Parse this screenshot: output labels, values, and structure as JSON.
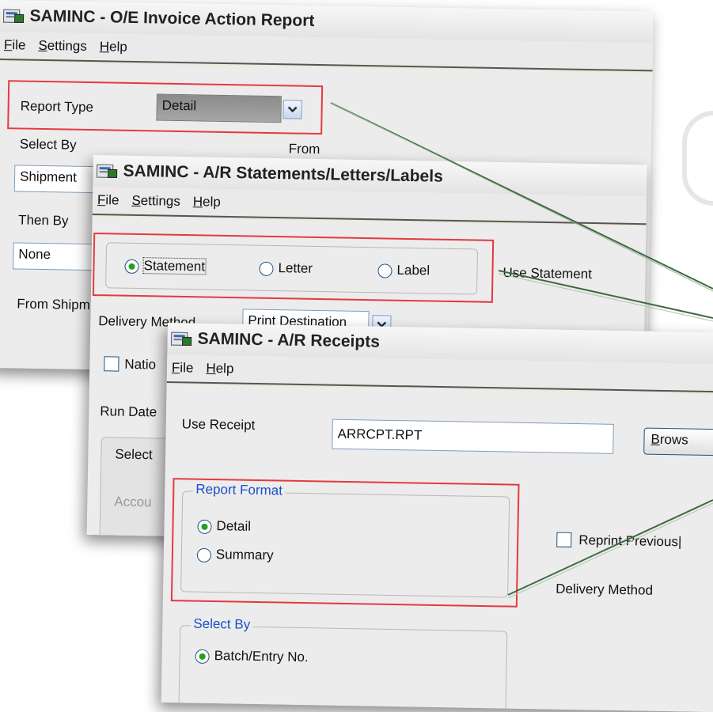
{
  "window1": {
    "title": "SAMINC - O/E Invoice Action Report",
    "menu": [
      "File",
      "Settings",
      "Help"
    ],
    "report_type_label": "Report Type",
    "report_type_value": "Detail",
    "select_by_label": "Select By",
    "select_by_value": "Shipment",
    "from_label": "From",
    "then_by_label": "Then By",
    "then_by_value": "None",
    "from_ship_label": "From Shipm"
  },
  "window2": {
    "title": "SAMINC - A/R Statements/Letters/Labels",
    "menu": [
      "File",
      "Settings",
      "Help"
    ],
    "radio_options": [
      "Statement",
      "Letter",
      "Label"
    ],
    "use_statement_label": "Use Statement",
    "delivery_method_label": "Delivery Method",
    "delivery_method_value": "Print Destination",
    "national_label": "Natio",
    "run_date_label": "Run Date",
    "select_label": "Select",
    "account_label": "Accou"
  },
  "window3": {
    "title": "SAMINC - A/R Receipts",
    "menu": [
      "File",
      "Help"
    ],
    "use_receipt_label": "Use Receipt",
    "use_receipt_value": "ARRCPT.RPT",
    "browse_label": "Brows",
    "report_format_legend": "Report Format",
    "report_format_options": [
      "Detail",
      "Summary"
    ],
    "reprint_label": "Reprint Previous|",
    "delivery_method_label": "Delivery Method",
    "select_by_legend": "Select By",
    "select_by_option": "Batch/Entry No."
  },
  "colors": {
    "highlight": "#e33a3f",
    "connector": "#3e6b3e",
    "legend_text": "#1b4fc9"
  }
}
